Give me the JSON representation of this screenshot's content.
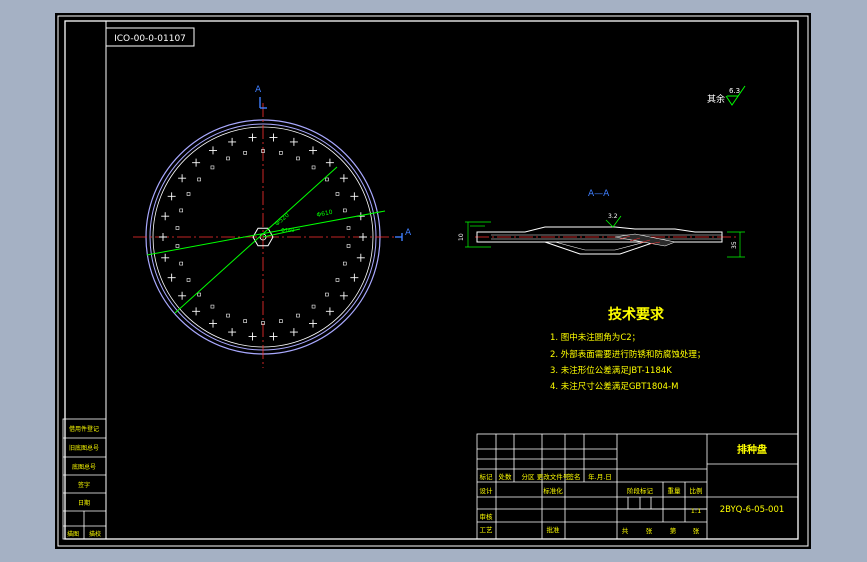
{
  "drawing_code_box": "ICO-00-0-01107",
  "section_marker": "A",
  "section_title": "A—A",
  "surface_note": {
    "label": "其余",
    "roughness": "6.3"
  },
  "dimensions": {
    "bolt_circle": "Φ520",
    "outer_circle": "Φ610",
    "hub_circle": "Φ160",
    "section_roughness": "3.2",
    "left_height": "10",
    "right_height": "35"
  },
  "tech_requirements": {
    "title": "技术要求",
    "items": [
      "1. 图中未注圆角为C2；",
      "2. 外部表面需要进行防锈和防腐蚀处理；",
      "3. 未注形位公差满足JBT-1184K",
      "4. 未注尺寸公差满足GBT1804-M"
    ]
  },
  "left_panel": {
    "cells": [
      "借用件登记",
      "旧底图总号",
      "底图总号",
      "签字",
      "日期"
    ],
    "bottom": [
      "描图",
      "描校"
    ]
  },
  "title_block": {
    "part_name": "排种盘",
    "drawing_number": "2BYQ-6-05-001",
    "scale": "1:1",
    "revision_headers": [
      "标记",
      "处数",
      "分区",
      "更改文件号",
      "签名",
      "年.月.日"
    ],
    "labels": {
      "design": "设计",
      "standardize": "标准化",
      "review": "审核",
      "process": "工艺",
      "approve": "批准",
      "stage_mark": "阶段标记",
      "weight": "重量",
      "scale_label": "比例",
      "total": "共",
      "sheets": "张",
      "sheet_no": "第",
      "sheet": "张"
    }
  }
}
